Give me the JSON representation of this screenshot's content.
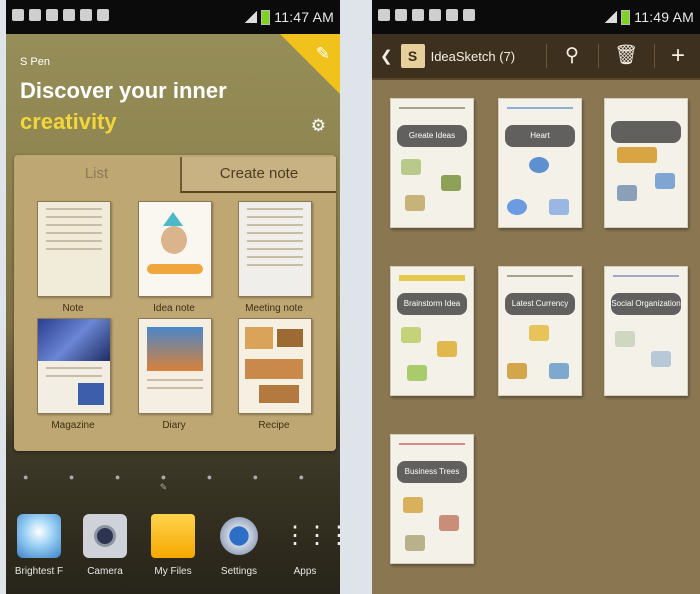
{
  "left": {
    "status": {
      "time": "11:47 AM"
    },
    "widget": {
      "eyebrow": "S Pen",
      "headline_1": "Discover your inner",
      "headline_2": "creativity"
    },
    "tabs": {
      "list": "List",
      "create": "Create note"
    },
    "templates": [
      {
        "label": "Note"
      },
      {
        "label": "Idea note"
      },
      {
        "label": "Meeting note"
      },
      {
        "label": "Magazine"
      },
      {
        "label": "Diary"
      },
      {
        "label": "Recipe"
      }
    ],
    "dock": [
      {
        "label": "Brightest F",
        "icon": "brightest-flashlight-icon"
      },
      {
        "label": "Camera",
        "icon": "camera-icon"
      },
      {
        "label": "My Files",
        "icon": "folder-icon"
      },
      {
        "label": "Settings",
        "icon": "gear-icon"
      },
      {
        "label": "Apps",
        "icon": "apps-grid-icon"
      }
    ]
  },
  "right": {
    "status": {
      "time": "11:49 AM"
    },
    "actionbar": {
      "app_glyph": "S",
      "title": "IdeaSketch (7)"
    },
    "sketches": [
      {
        "caption": "Greate Ideas"
      },
      {
        "caption": "Heart"
      },
      {
        "caption": ""
      },
      {
        "caption": "Brainstorm Idea"
      },
      {
        "caption": "Latest Currency"
      },
      {
        "caption": "Social Organization"
      },
      {
        "caption": "Business Trees"
      }
    ]
  }
}
